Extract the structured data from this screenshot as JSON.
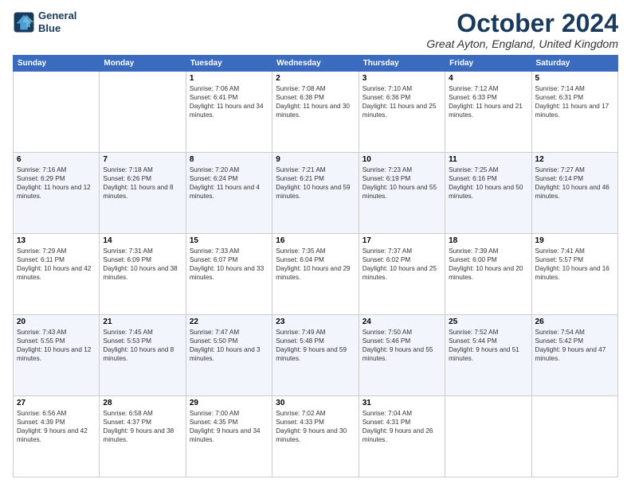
{
  "logo": {
    "line1": "General",
    "line2": "Blue"
  },
  "title": {
    "month_year": "October 2024",
    "location": "Great Ayton, England, United Kingdom"
  },
  "columns": [
    "Sunday",
    "Monday",
    "Tuesday",
    "Wednesday",
    "Thursday",
    "Friday",
    "Saturday"
  ],
  "weeks": [
    [
      {
        "day": "",
        "sunrise": "",
        "sunset": "",
        "daylight": ""
      },
      {
        "day": "",
        "sunrise": "",
        "sunset": "",
        "daylight": ""
      },
      {
        "day": "1",
        "sunrise": "Sunrise: 7:06 AM",
        "sunset": "Sunset: 6:41 PM",
        "daylight": "Daylight: 11 hours and 34 minutes."
      },
      {
        "day": "2",
        "sunrise": "Sunrise: 7:08 AM",
        "sunset": "Sunset: 6:38 PM",
        "daylight": "Daylight: 11 hours and 30 minutes."
      },
      {
        "day": "3",
        "sunrise": "Sunrise: 7:10 AM",
        "sunset": "Sunset: 6:36 PM",
        "daylight": "Daylight: 11 hours and 25 minutes."
      },
      {
        "day": "4",
        "sunrise": "Sunrise: 7:12 AM",
        "sunset": "Sunset: 6:33 PM",
        "daylight": "Daylight: 11 hours and 21 minutes."
      },
      {
        "day": "5",
        "sunrise": "Sunrise: 7:14 AM",
        "sunset": "Sunset: 6:31 PM",
        "daylight": "Daylight: 11 hours and 17 minutes."
      }
    ],
    [
      {
        "day": "6",
        "sunrise": "Sunrise: 7:16 AM",
        "sunset": "Sunset: 6:29 PM",
        "daylight": "Daylight: 11 hours and 12 minutes."
      },
      {
        "day": "7",
        "sunrise": "Sunrise: 7:18 AM",
        "sunset": "Sunset: 6:26 PM",
        "daylight": "Daylight: 11 hours and 8 minutes."
      },
      {
        "day": "8",
        "sunrise": "Sunrise: 7:20 AM",
        "sunset": "Sunset: 6:24 PM",
        "daylight": "Daylight: 11 hours and 4 minutes."
      },
      {
        "day": "9",
        "sunrise": "Sunrise: 7:21 AM",
        "sunset": "Sunset: 6:21 PM",
        "daylight": "Daylight: 10 hours and 59 minutes."
      },
      {
        "day": "10",
        "sunrise": "Sunrise: 7:23 AM",
        "sunset": "Sunset: 6:19 PM",
        "daylight": "Daylight: 10 hours and 55 minutes."
      },
      {
        "day": "11",
        "sunrise": "Sunrise: 7:25 AM",
        "sunset": "Sunset: 6:16 PM",
        "daylight": "Daylight: 10 hours and 50 minutes."
      },
      {
        "day": "12",
        "sunrise": "Sunrise: 7:27 AM",
        "sunset": "Sunset: 6:14 PM",
        "daylight": "Daylight: 10 hours and 46 minutes."
      }
    ],
    [
      {
        "day": "13",
        "sunrise": "Sunrise: 7:29 AM",
        "sunset": "Sunset: 6:11 PM",
        "daylight": "Daylight: 10 hours and 42 minutes."
      },
      {
        "day": "14",
        "sunrise": "Sunrise: 7:31 AM",
        "sunset": "Sunset: 6:09 PM",
        "daylight": "Daylight: 10 hours and 38 minutes."
      },
      {
        "day": "15",
        "sunrise": "Sunrise: 7:33 AM",
        "sunset": "Sunset: 6:07 PM",
        "daylight": "Daylight: 10 hours and 33 minutes."
      },
      {
        "day": "16",
        "sunrise": "Sunrise: 7:35 AM",
        "sunset": "Sunset: 6:04 PM",
        "daylight": "Daylight: 10 hours and 29 minutes."
      },
      {
        "day": "17",
        "sunrise": "Sunrise: 7:37 AM",
        "sunset": "Sunset: 6:02 PM",
        "daylight": "Daylight: 10 hours and 25 minutes."
      },
      {
        "day": "18",
        "sunrise": "Sunrise: 7:39 AM",
        "sunset": "Sunset: 6:00 PM",
        "daylight": "Daylight: 10 hours and 20 minutes."
      },
      {
        "day": "19",
        "sunrise": "Sunrise: 7:41 AM",
        "sunset": "Sunset: 5:57 PM",
        "daylight": "Daylight: 10 hours and 16 minutes."
      }
    ],
    [
      {
        "day": "20",
        "sunrise": "Sunrise: 7:43 AM",
        "sunset": "Sunset: 5:55 PM",
        "daylight": "Daylight: 10 hours and 12 minutes."
      },
      {
        "day": "21",
        "sunrise": "Sunrise: 7:45 AM",
        "sunset": "Sunset: 5:53 PM",
        "daylight": "Daylight: 10 hours and 8 minutes."
      },
      {
        "day": "22",
        "sunrise": "Sunrise: 7:47 AM",
        "sunset": "Sunset: 5:50 PM",
        "daylight": "Daylight: 10 hours and 3 minutes."
      },
      {
        "day": "23",
        "sunrise": "Sunrise: 7:49 AM",
        "sunset": "Sunset: 5:48 PM",
        "daylight": "Daylight: 9 hours and 59 minutes."
      },
      {
        "day": "24",
        "sunrise": "Sunrise: 7:50 AM",
        "sunset": "Sunset: 5:46 PM",
        "daylight": "Daylight: 9 hours and 55 minutes."
      },
      {
        "day": "25",
        "sunrise": "Sunrise: 7:52 AM",
        "sunset": "Sunset: 5:44 PM",
        "daylight": "Daylight: 9 hours and 51 minutes."
      },
      {
        "day": "26",
        "sunrise": "Sunrise: 7:54 AM",
        "sunset": "Sunset: 5:42 PM",
        "daylight": "Daylight: 9 hours and 47 minutes."
      }
    ],
    [
      {
        "day": "27",
        "sunrise": "Sunrise: 6:56 AM",
        "sunset": "Sunset: 4:39 PM",
        "daylight": "Daylight: 9 hours and 42 minutes."
      },
      {
        "day": "28",
        "sunrise": "Sunrise: 6:58 AM",
        "sunset": "Sunset: 4:37 PM",
        "daylight": "Daylight: 9 hours and 38 minutes."
      },
      {
        "day": "29",
        "sunrise": "Sunrise: 7:00 AM",
        "sunset": "Sunset: 4:35 PM",
        "daylight": "Daylight: 9 hours and 34 minutes."
      },
      {
        "day": "30",
        "sunrise": "Sunrise: 7:02 AM",
        "sunset": "Sunset: 4:33 PM",
        "daylight": "Daylight: 9 hours and 30 minutes."
      },
      {
        "day": "31",
        "sunrise": "Sunrise: 7:04 AM",
        "sunset": "Sunset: 4:31 PM",
        "daylight": "Daylight: 9 hours and 26 minutes."
      },
      {
        "day": "",
        "sunrise": "",
        "sunset": "",
        "daylight": ""
      },
      {
        "day": "",
        "sunrise": "",
        "sunset": "",
        "daylight": ""
      }
    ]
  ]
}
